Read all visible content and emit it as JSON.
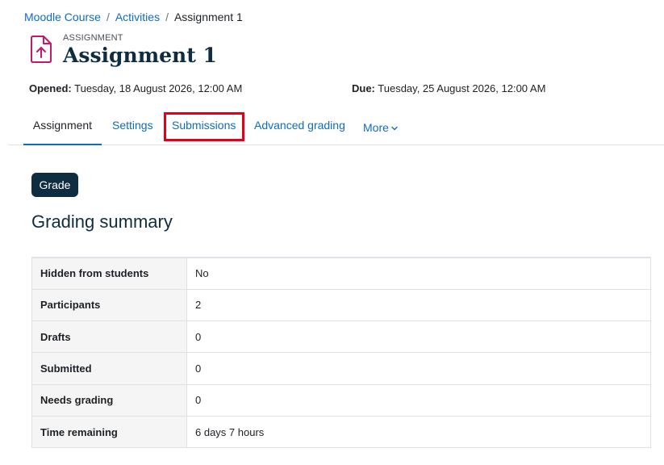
{
  "breadcrumb": {
    "items": [
      "Moodle Course",
      "Activities"
    ],
    "current": "Assignment 1",
    "separator": "/"
  },
  "header": {
    "modname": "ASSIGNMENT",
    "title": "Assignment 1",
    "icon": "assignment-upload-icon",
    "icon_color": "#c3186b"
  },
  "dates": {
    "opened_label": "Opened:",
    "opened_value": "Tuesday, 18 August 2026, 12:00 AM",
    "due_label": "Due:",
    "due_value": "Tuesday, 25 August 2026, 12:00 AM"
  },
  "tabs": [
    {
      "label": "Assignment",
      "active": true
    },
    {
      "label": "Settings",
      "active": false
    },
    {
      "label": "Submissions",
      "active": false,
      "highlighted": true
    },
    {
      "label": "Advanced grading",
      "active": false
    },
    {
      "label": "More",
      "active": false,
      "icon": "chevron-down-icon"
    }
  ],
  "actions": {
    "grade_label": "Grade"
  },
  "summary": {
    "title": "Grading summary",
    "rows": [
      {
        "label": "Hidden from students",
        "value": "No"
      },
      {
        "label": "Participants",
        "value": "2"
      },
      {
        "label": "Drafts",
        "value": "0"
      },
      {
        "label": "Submitted",
        "value": "0"
      },
      {
        "label": "Needs grading",
        "value": "0"
      },
      {
        "label": "Time remaining",
        "value": "6 days 7 hours"
      }
    ]
  },
  "colors": {
    "link": "#0f6cbf",
    "brand_dark": "#0f2d40",
    "highlight": "#e2001a"
  }
}
